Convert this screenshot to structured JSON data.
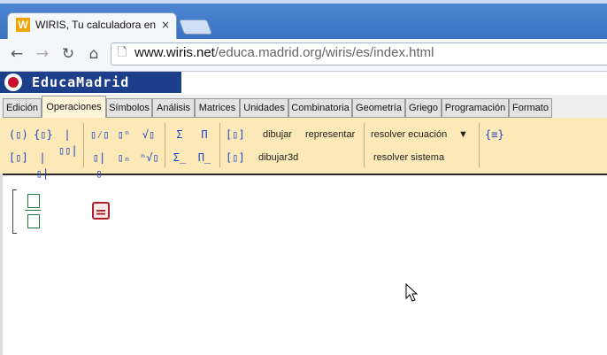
{
  "browser": {
    "tab_title": "WIRIS, Tu calculadora en l",
    "tab_logo": "W",
    "tab_close": "×",
    "url_domain": "www.wiris.net",
    "url_path": "/educa.madrid.org/wiris/es/index.html",
    "nav": {
      "back": "←",
      "forward": "→",
      "reload": "↻",
      "home": "⌂",
      "page": "🗋"
    }
  },
  "banner": {
    "text": "EducaMadrid"
  },
  "tabs": [
    {
      "label": "Edición"
    },
    {
      "label": "Operaciones",
      "active": true
    },
    {
      "label": "Símbolos"
    },
    {
      "label": "Análisis"
    },
    {
      "label": "Matrices"
    },
    {
      "label": "Unidades"
    },
    {
      "label": "Combinatoria"
    },
    {
      "label": "Geometría"
    },
    {
      "label": "Griego"
    },
    {
      "label": "Programación"
    },
    {
      "label": "Formato"
    }
  ],
  "palette": {
    "symbols_row1": [
      "(▯)",
      "{▯}",
      "|▯▯|",
      "▯⁄▯",
      "▯ⁿ",
      "√▯",
      "Σ",
      "Π",
      "[▯]"
    ],
    "symbols_row2": [
      "[▯]",
      "|▯|",
      "▯|▯",
      "▯ₙ",
      "ⁿ√▯",
      "Σ̲",
      "Π̲",
      "[▯]"
    ],
    "commands": {
      "dibujar": "dibujar",
      "representar": "representar",
      "resolver_ecuacion": "resolver ecuación",
      "dropdown": "▼",
      "dibujar3d": "dibujar3d",
      "resolver_sistema": "resolver sistema",
      "block": "{≡}"
    }
  },
  "editor": {
    "calc_button": "="
  }
}
